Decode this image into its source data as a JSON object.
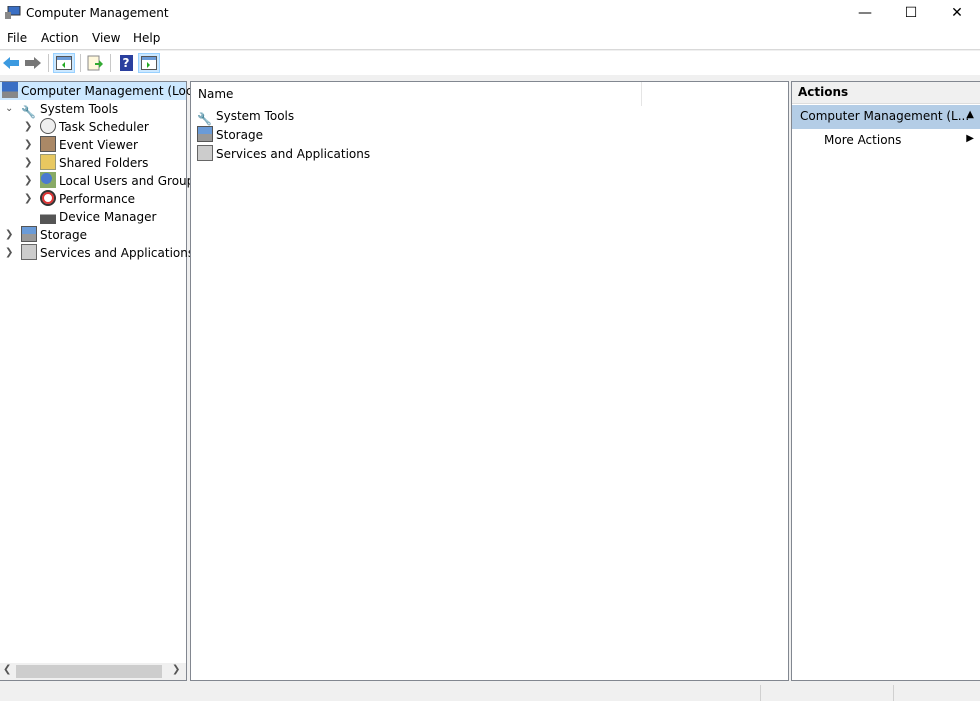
{
  "window": {
    "title": "Computer Management",
    "minimize": "—",
    "maximize": "☐",
    "close": "✕"
  },
  "menu": [
    "File",
    "Action",
    "View",
    "Help"
  ],
  "toolbar": {
    "help_label": "?"
  },
  "tree": {
    "root": "Computer Management (Local",
    "items": [
      {
        "label": "System Tools",
        "expanded": true,
        "children": [
          "Task Scheduler",
          "Event Viewer",
          "Shared Folders",
          "Local Users and Groups",
          "Performance",
          "Device Manager"
        ]
      },
      {
        "label": "Storage"
      },
      {
        "label": "Services and Applications"
      }
    ]
  },
  "list": {
    "column": "Name",
    "items": [
      "System Tools",
      "Storage",
      "Services and Applications"
    ]
  },
  "actions": {
    "header": "Actions",
    "section": "Computer Management (L...",
    "more": "More Actions"
  },
  "colors": {
    "selection": "#cce8ff",
    "section": "#b4cde6"
  }
}
